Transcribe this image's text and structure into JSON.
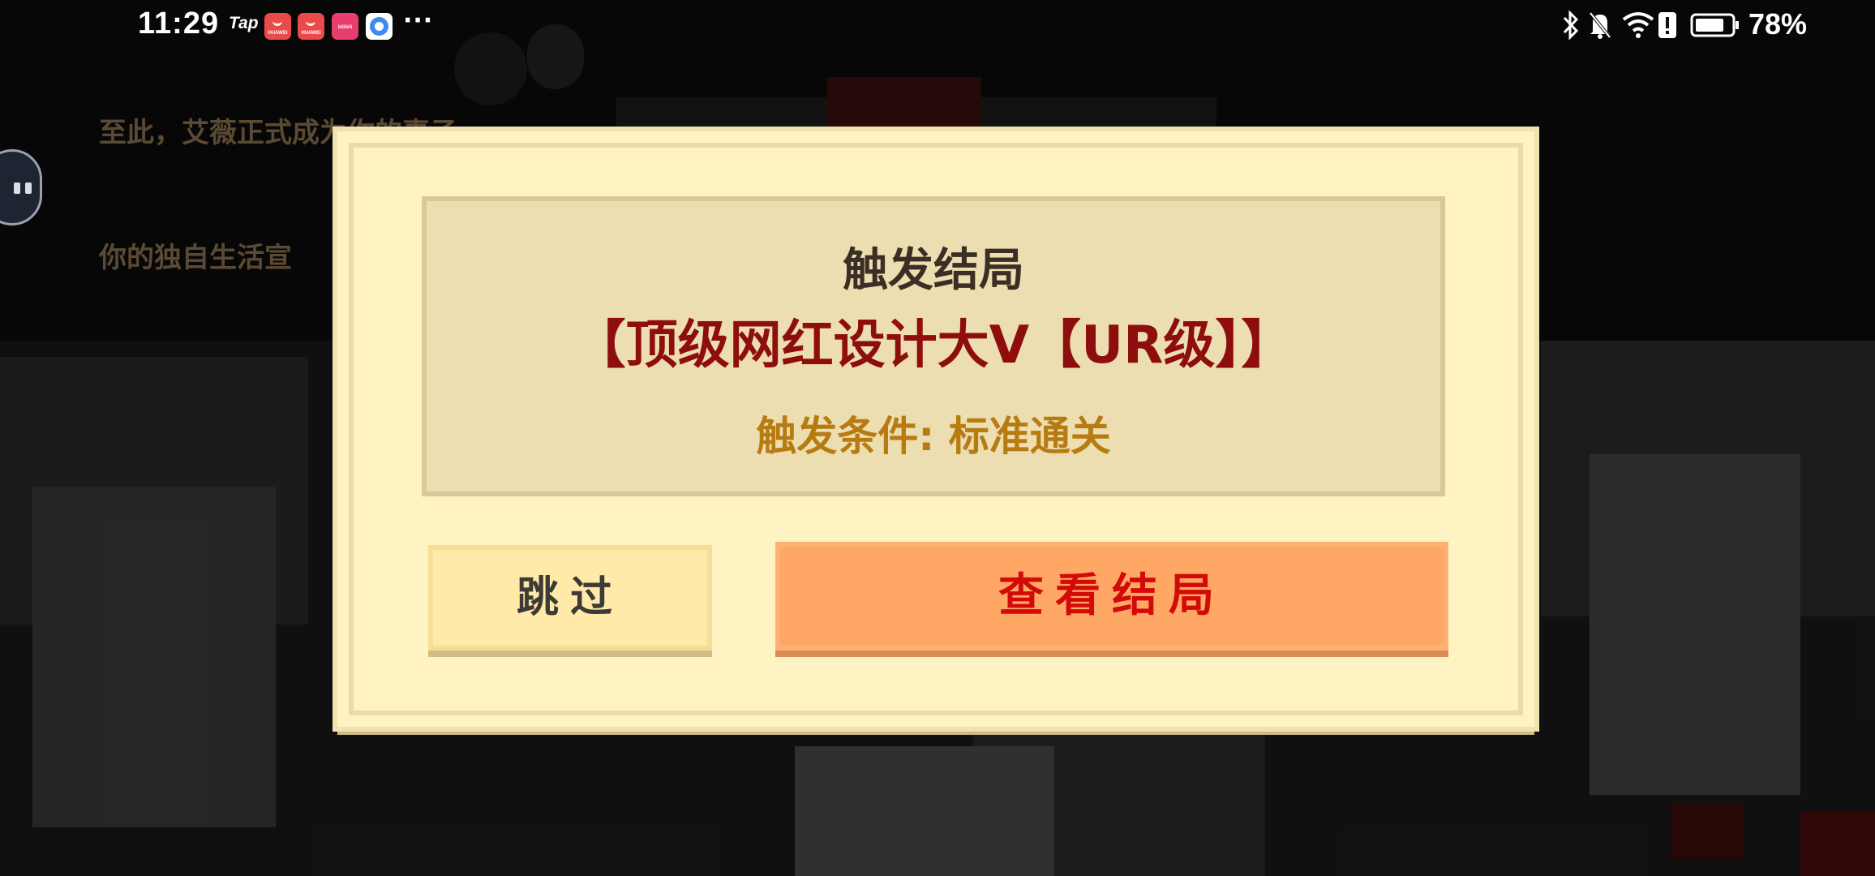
{
  "status_bar": {
    "time": "11:29",
    "tap_label": "Tap",
    "notification_apps": [
      "huawei-store-icon",
      "huawei-store-icon",
      "bilibili-icon",
      "browser-icon"
    ],
    "huawei_label": "HUAWEI",
    "bilibili_label": "bilibili",
    "more": "···",
    "battery_percent": "78%",
    "system_icons": [
      "bluetooth-icon",
      "bell-off-icon",
      "wifi-icon",
      "alert-icon",
      "battery-icon"
    ]
  },
  "story": {
    "line1": "至此，艾薇正式成为你的妻子。",
    "line2": "你的独自生活宣"
  },
  "dialog": {
    "title": "触发结局",
    "ending_name": "【顶级网红设计大V【UR级】】",
    "condition": "触发条件: 标准通关",
    "skip_label": "跳过",
    "view_label": "查看结局"
  },
  "colors": {
    "dialog_bg": "#fff3c4",
    "panel_bg": "#ecdeb1",
    "ending_name": "#8e0e0e",
    "condition": "#b77b12",
    "skip_button": "#ffeaa9",
    "view_button": "#ffa765",
    "view_text": "#d20a0a"
  }
}
